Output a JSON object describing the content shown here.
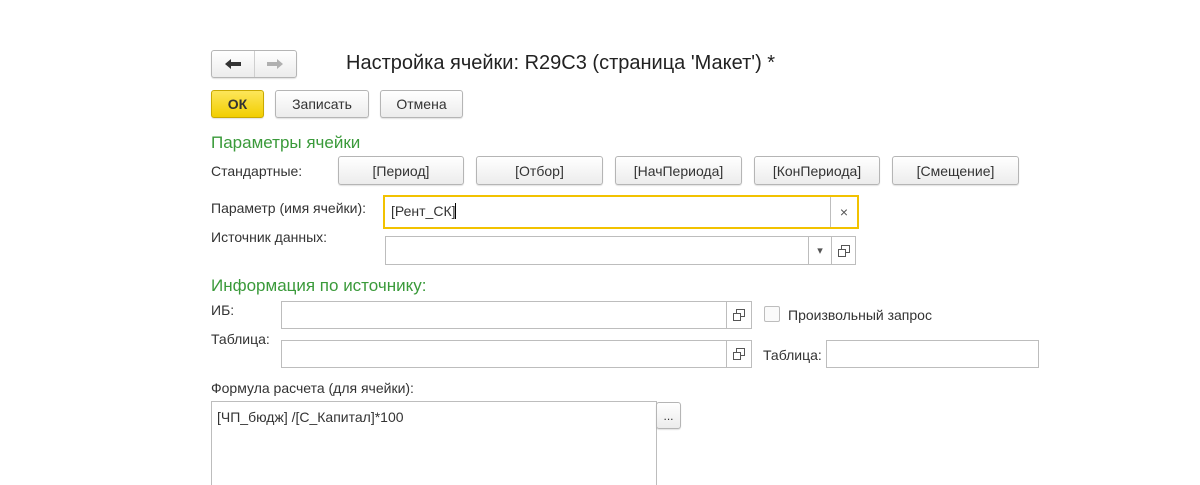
{
  "window": {
    "title": "Настройка ячейки: R29C3 (страница 'Макет') *"
  },
  "toolbar": {
    "back_label": "←",
    "forward_label": "→",
    "ok_label": "ОК",
    "save_label": "Записать",
    "cancel_label": "Отмена"
  },
  "cell_params": {
    "section_title": "Параметры ячейки",
    "standard_label": "Стандартные:",
    "standard_buttons": [
      "[Период]",
      "[Отбор]",
      "[НачПериода]",
      "[КонПериода]",
      "[Смещение]"
    ],
    "param_label": "Параметр (имя ячейки):",
    "param_value": "[Рент_СК]",
    "clear_icon": "×",
    "source_label": "Источник данных:",
    "source_value": "",
    "dropdown_icon": "▾"
  },
  "source_info": {
    "section_title": "Информация по источнику:",
    "ib_label": "ИБ:",
    "ib_value": "",
    "arbitrary_query_label": "Произвольный запрос",
    "arbitrary_query_checked": false,
    "table_label": "Таблица:",
    "table_value": "",
    "table2_label": "Таблица:",
    "table2_value": ""
  },
  "formula": {
    "label": "Формула расчета (для ячейки):",
    "value": "[ЧП_бюдж] /[С_Капитал]*100",
    "select_button": "..."
  },
  "colors": {
    "accent_green": "#3a9a3a",
    "ok_yellow": "#f2ce00",
    "focus_border": "#f2c200"
  }
}
